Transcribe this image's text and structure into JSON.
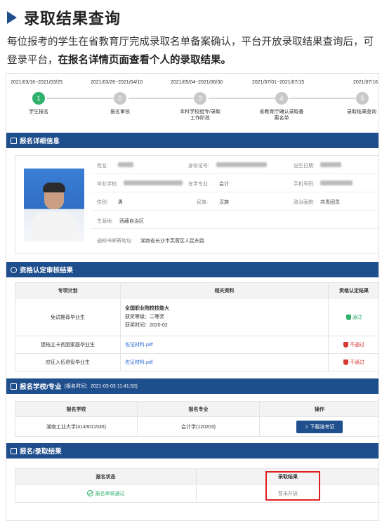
{
  "header": {
    "title": "录取结果查询",
    "intro_plain": "每位报考的学生在省教育厅完成录取名单备案确认，平台开放录取结果查询后，可登录平台，",
    "intro_bold": "在报名详情页面查看个人的录取结果。"
  },
  "steps": [
    {
      "date": "2021/03/16~2021/03/25",
      "num": "1",
      "label": "学生报名",
      "done": true
    },
    {
      "date": "2021/03/26~2021/04/10",
      "num": "2",
      "label": "报名审核",
      "done": false
    },
    {
      "date": "2021/05/04~2021/06/30",
      "num": "3",
      "label": "本科学校组专/录取工作阶段",
      "done": false
    },
    {
      "date": "2021/07/01~2021/07/15",
      "num": "4",
      "label": "省教育厅确认录取备案名单",
      "done": false
    },
    {
      "date": "2021/07/16",
      "num": "5",
      "label": "录取结果查询",
      "done": false
    }
  ],
  "detail": {
    "section_title": "报名详细信息",
    "name_label": "姓名:",
    "id_label": "身份证号:",
    "birth_label": "出生日期:",
    "school_label": "毕业学校:",
    "major_label": "在学专业:",
    "major_value": "会计",
    "phone_label": "手机号码:",
    "gender_label": "性别:",
    "gender_value": "男",
    "ethnic_label": "民族:",
    "ethnic_value": "汉族",
    "political_label": "政治面貌:",
    "political_value": "共青团员",
    "origin_label": "生源地:",
    "origin_value": "西藏自治区",
    "address_label": "通知书邮寄地址:",
    "address_value": "湖南省长沙市芙蓉区人民东路"
  },
  "qualification": {
    "section_title": "资格认定审核结果",
    "headers": [
      "专项计划",
      "相关资料",
      "资格认定结果"
    ],
    "rows": [
      {
        "plan": "免试推荐毕业生",
        "material_lines": [
          "全国职业院校技能大",
          "获奖等级：二等奖",
          "获奖时间：2020-02"
        ],
        "result": "通过",
        "status": "pass"
      },
      {
        "plan": "建档立卡贫困家庭毕业生",
        "material_lines": [
          "佐证材料.pdf"
        ],
        "result": "不通过",
        "status": "fail"
      },
      {
        "plan": "应征入伍退役毕业生",
        "material_lines": [
          "佐证材料.pdf"
        ],
        "result": "不通过",
        "status": "fail"
      }
    ]
  },
  "school": {
    "section_title": "报名学校/专业",
    "section_sub": "(报名时间：2021-03-03 11:41:53)",
    "headers": [
      "报名学校",
      "报名专业",
      "操作"
    ],
    "school_value": "湖南工业大学(4143011535)",
    "major_value": "会计学(120203)",
    "download_label": "下载准考证"
  },
  "result": {
    "section_title": "报名/录取结果",
    "headers": [
      "报名状态",
      "录取结果"
    ],
    "status_value": "报名审核通过",
    "admission_value": "暂未开放"
  },
  "colors": {
    "primary": "#1f4e8c",
    "success": "#2fb06b",
    "danger": "#d53a35",
    "highlight": "#e02020"
  }
}
